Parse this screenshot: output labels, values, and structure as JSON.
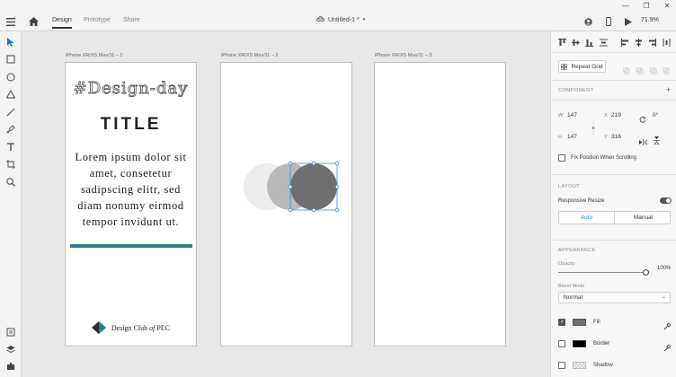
{
  "tabs": [
    {
      "label": "Design",
      "active": true
    },
    {
      "label": "Prototype",
      "active": false
    },
    {
      "label": "Share",
      "active": false
    }
  ],
  "document": {
    "title": "Untitled-1 *"
  },
  "zoom": "71.9%",
  "artboards": [
    {
      "label": "iPhone XR/XS Max/11 – 1"
    },
    {
      "label": "iPhone XR/XS Max/11 – 2"
    },
    {
      "label": "iPhone XR/XS Max/11 – 3"
    }
  ],
  "artboard1": {
    "hashtag": "#Design-day",
    "title": "TITLE",
    "lorem": "Lorem ipsum dolor sit amet, consetetur sadipscing elitr, sed diam nonumy eirmod tempor invidunt ut.",
    "brand_prefix": "Design Club",
    "brand_of": "of",
    "brand_suffix": "PEC",
    "accent_color": "#2f7d8a"
  },
  "panel": {
    "repeat_grid": "Repeat Grid",
    "component_label": "COMPONENT",
    "w_label": "W",
    "w_value": "147",
    "x_label": "X",
    "x_value": "219",
    "h_label": "H",
    "h_value": "147",
    "y_label": "Y",
    "y_value": "316",
    "rotation": "0°",
    "fix_position": "Fix Position When Scrolling",
    "layout_label": "LAYOUT",
    "responsive_resize": "Responsive Resize",
    "auto": "Auto",
    "manual": "Manual",
    "appearance_label": "APPEARANCE",
    "opacity_label": "Opacity",
    "opacity_value": "100%",
    "blend_label": "Blend Mode",
    "blend_value": "Normal",
    "fill_label": "Fill",
    "fill_color": "#707070",
    "border_label": "Border",
    "border_color": "#000000",
    "shadow_label": "Shadow"
  }
}
